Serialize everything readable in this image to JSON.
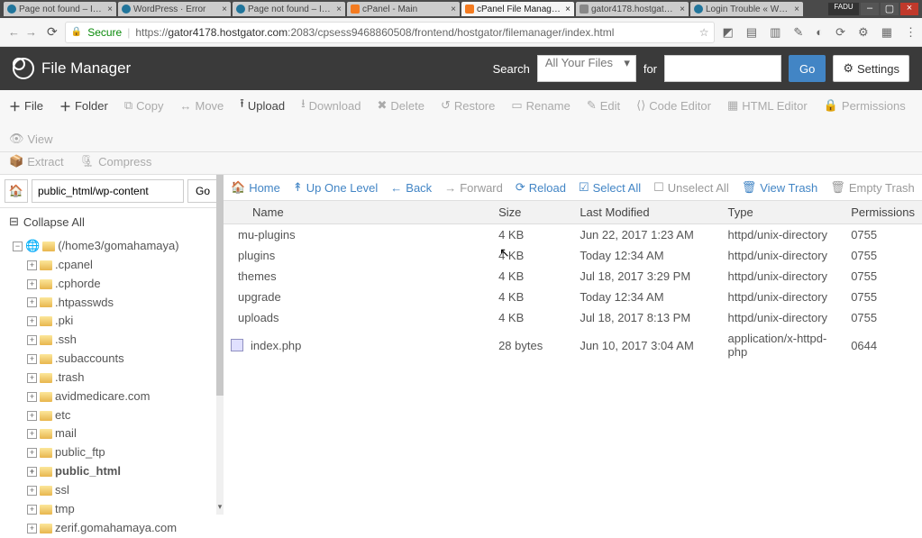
{
  "tabs": [
    {
      "label": "Page not found – I…",
      "fav": "wp"
    },
    {
      "label": "WordPress · Error",
      "fav": "wp"
    },
    {
      "label": "Page not found – I…",
      "fav": "wp"
    },
    {
      "label": "cPanel - Main",
      "fav": "cp"
    },
    {
      "label": "cPanel File Manag…",
      "fav": "cp",
      "active": true
    },
    {
      "label": "gator4178.hostgat…",
      "fav": ""
    },
    {
      "label": "Login Trouble « W…",
      "fav": "wp"
    }
  ],
  "addr": {
    "secure": "Secure",
    "url_prefix": "https://",
    "url_host": "gator4178.hostgator.com",
    "url_rest": ":2083/cpsess9468860508/frontend/hostgator/filemanager/index.html"
  },
  "app": {
    "title": "File Manager",
    "search_label": "Search",
    "search_sel": "All Your Files",
    "for": "for",
    "go": "Go",
    "settings": "Settings"
  },
  "toolbar": {
    "file": "File",
    "folder": "Folder",
    "copy": "Copy",
    "move": "Move",
    "upload": "Upload",
    "download": "Download",
    "delete": "Delete",
    "restore": "Restore",
    "rename": "Rename",
    "edit": "Edit",
    "code": "Code Editor",
    "html": "HTML Editor",
    "perm": "Permissions",
    "view": "View",
    "extract": "Extract",
    "compress": "Compress"
  },
  "path": {
    "value": "public_html/wp-content",
    "go": "Go"
  },
  "collapse": "Collapse All",
  "tree": {
    "root": "(/home3/gomahamaya)",
    "children": [
      ".cpanel",
      ".cphorde",
      ".htpasswds",
      ".pki",
      ".ssh",
      ".subaccounts",
      ".trash",
      "avidmedicare.com",
      "etc",
      "mail",
      "public_ftp",
      "public_html",
      "ssl",
      "tmp",
      "zerif.gomahamaya.com"
    ]
  },
  "actions": {
    "home": "Home",
    "up": "Up One Level",
    "back": "Back",
    "forward": "Forward",
    "reload": "Reload",
    "selall": "Select All",
    "unsel": "Unselect All",
    "trash": "View Trash",
    "empty": "Empty Trash"
  },
  "cols": {
    "name": "Name",
    "size": "Size",
    "mod": "Last Modified",
    "type": "Type",
    "perm": "Permissions"
  },
  "rows": [
    {
      "name": "mu-plugins",
      "size": "4 KB",
      "mod": "Jun 22, 2017 1:23 AM",
      "type": "httpd/unix-directory",
      "perm": "0755",
      "kind": "dir"
    },
    {
      "name": "plugins",
      "size": "4 KB",
      "mod": "Today 12:34 AM",
      "type": "httpd/unix-directory",
      "perm": "0755",
      "kind": "dir"
    },
    {
      "name": "themes",
      "size": "4 KB",
      "mod": "Jul 18, 2017 3:29 PM",
      "type": "httpd/unix-directory",
      "perm": "0755",
      "kind": "dir"
    },
    {
      "name": "upgrade",
      "size": "4 KB",
      "mod": "Today 12:34 AM",
      "type": "httpd/unix-directory",
      "perm": "0755",
      "kind": "dir"
    },
    {
      "name": "uploads",
      "size": "4 KB",
      "mod": "Jul 18, 2017 8:13 PM",
      "type": "httpd/unix-directory",
      "perm": "0755",
      "kind": "dir"
    },
    {
      "name": "index.php",
      "size": "28 bytes",
      "mod": "Jun 10, 2017 3:04 AM",
      "type": "application/x-httpd-php",
      "perm": "0644",
      "kind": "php"
    }
  ]
}
